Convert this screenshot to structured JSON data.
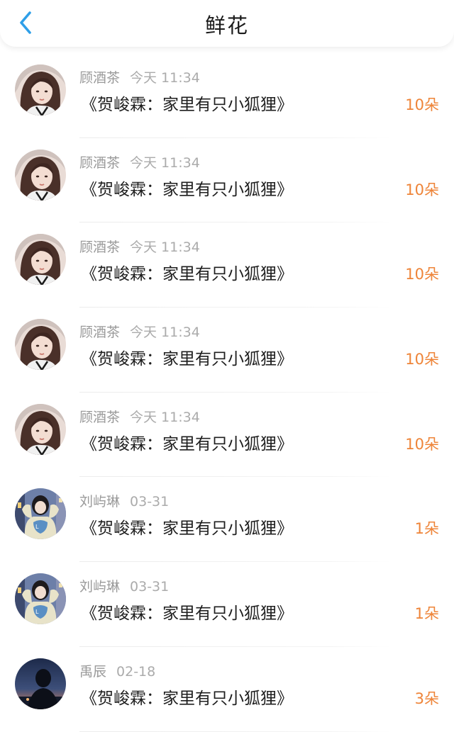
{
  "header": {
    "title": "鲜花",
    "accent_color": "#2f9fe8"
  },
  "colors": {
    "count": "#ee8438"
  },
  "gifts": [
    {
      "user": "顾酒茶",
      "time": "今天 11:34",
      "book": "《贺峻霖：家里有只小狐狸》",
      "count": "10朵",
      "avatar": "girl-portrait"
    },
    {
      "user": "顾酒茶",
      "time": "今天 11:34",
      "book": "《贺峻霖：家里有只小狐狸》",
      "count": "10朵",
      "avatar": "girl-portrait"
    },
    {
      "user": "顾酒茶",
      "time": "今天 11:34",
      "book": "《贺峻霖：家里有只小狐狸》",
      "count": "10朵",
      "avatar": "girl-portrait"
    },
    {
      "user": "顾酒茶",
      "time": "今天 11:34",
      "book": "《贺峻霖：家里有只小狐狸》",
      "count": "10朵",
      "avatar": "girl-portrait"
    },
    {
      "user": "顾酒茶",
      "time": "今天 11:34",
      "book": "《贺峻霖：家里有只小狐狸》",
      "count": "10朵",
      "avatar": "girl-portrait"
    },
    {
      "user": "刘屿琳",
      "time": "03-31",
      "book": "《贺峻霖：家里有只小狐狸》",
      "count": "1朵",
      "avatar": "girl-look-sweater"
    },
    {
      "user": "刘屿琳",
      "time": "03-31",
      "book": "《贺峻霖：家里有只小狐狸》",
      "count": "1朵",
      "avatar": "girl-look-sweater"
    },
    {
      "user": "禹辰",
      "time": "02-18",
      "book": "《贺峻霖：家里有只小狐狸》",
      "count": "3朵",
      "avatar": "silhouette-night"
    }
  ]
}
